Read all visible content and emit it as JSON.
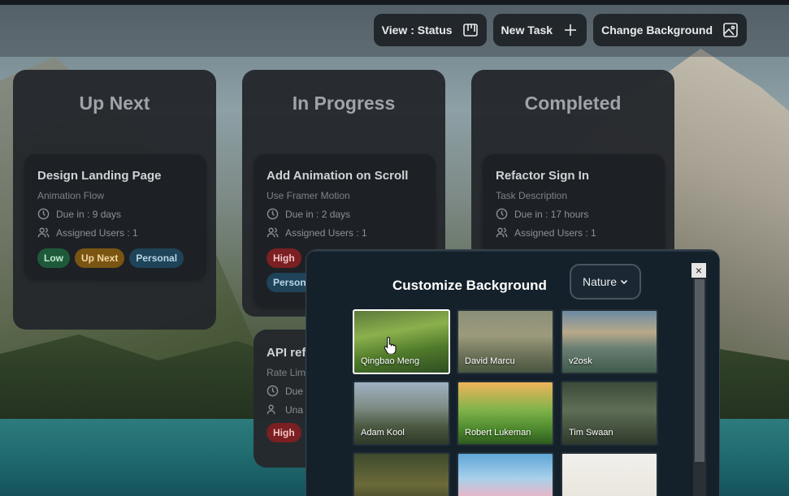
{
  "toolbar": {
    "view_label": "View : Status",
    "new_task_label": "New Task",
    "change_bg_label": "Change Background"
  },
  "columns": [
    {
      "title": "Up Next",
      "cards": [
        {
          "title": "Design Landing Page",
          "subtitle": "Animation Flow",
          "due": "Due in : 9 days",
          "assigned": "Assigned Users : 1",
          "tags": [
            "Low",
            "Up Next",
            "Personal"
          ]
        }
      ]
    },
    {
      "title": "In Progress",
      "cards": [
        {
          "title": "Add Animation on Scroll",
          "subtitle": "Use Framer Motion",
          "due": "Due in : 2 days",
          "assigned": "Assigned Users : 1",
          "tags": [
            "High",
            "Person"
          ]
        },
        {
          "title": "API ref",
          "subtitle": "Rate Lim",
          "due": "Due",
          "assigned": "Una",
          "tags": [
            "High"
          ]
        }
      ]
    },
    {
      "title": "Completed",
      "cards": [
        {
          "title": "Refactor Sign In",
          "subtitle": "Task Description",
          "due": "Due in : 17 hours",
          "assigned": "Assigned Users : 1",
          "tags": []
        }
      ]
    }
  ],
  "modal": {
    "title": "Customize Background",
    "category": "Nature",
    "close_label": "×",
    "images": [
      {
        "author": "Qingbao Meng",
        "selected": true
      },
      {
        "author": "David Marcu",
        "selected": false
      },
      {
        "author": "v2osk",
        "selected": false
      },
      {
        "author": "Adam Kool",
        "selected": false
      },
      {
        "author": "Robert Lukeman",
        "selected": false
      },
      {
        "author": "Tim Swaan",
        "selected": false
      },
      {
        "author": "",
        "selected": false
      },
      {
        "author": "",
        "selected": false
      },
      {
        "author": "",
        "selected": false
      }
    ]
  },
  "colors": {
    "tag_low": "#1e5a3a",
    "tag_upnext": "#7a5512",
    "tag_personal": "#1f4358",
    "tag_high": "#7a1f22"
  }
}
